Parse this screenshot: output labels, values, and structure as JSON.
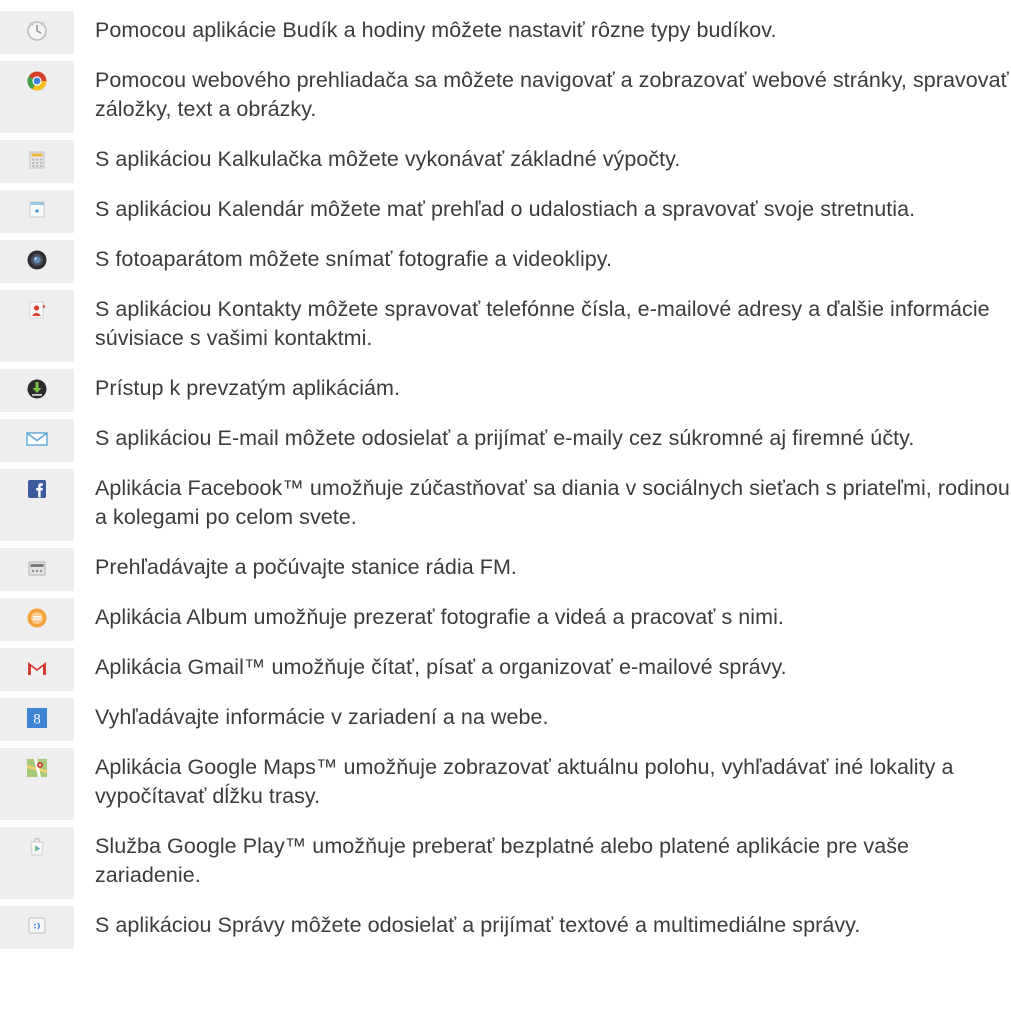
{
  "items": [
    {
      "icon": "clock-icon",
      "text": "Pomocou aplikácie Budík a hodiny môžete nastaviť rôzne typy budíkov."
    },
    {
      "icon": "browser-icon",
      "text": "Pomocou webového prehliadača sa môžete navigovať a zobrazovať webové stránky, spravovať záložky, text a obrázky."
    },
    {
      "icon": "calculator-icon",
      "text": "S aplikáciou Kalkulačka môžete vykonávať základné výpočty."
    },
    {
      "icon": "calendar-icon",
      "text": "S aplikáciou Kalendár môžete mať prehľad o udalostiach a spravovať svoje stretnutia."
    },
    {
      "icon": "camera-icon",
      "text": "S fotoaparátom môžete snímať fotografie a videoklipy."
    },
    {
      "icon": "contacts-icon",
      "text": "S aplikáciou Kontakty môžete spravovať telefónne čísla, e-mailové adresy a ďalšie informácie súvisiace s vašimi kontaktmi."
    },
    {
      "icon": "download-icon",
      "text": "Prístup k prevzatým aplikáciám."
    },
    {
      "icon": "email-icon",
      "text": "S aplikáciou E-mail môžete odosielať a prijímať e-maily cez súkromné aj firemné účty."
    },
    {
      "icon": "facebook-icon",
      "text": "Aplikácia Facebook™ umožňuje zúčastňovať sa diania v sociálnych sieťach s priateľmi, rodinou a kolegami po celom svete."
    },
    {
      "icon": "fm-radio-icon",
      "text": "Prehľadávajte a počúvajte stanice rádia FM."
    },
    {
      "icon": "album-icon",
      "text": "Aplikácia Album umožňuje prezerať fotografie a videá a pracovať s nimi."
    },
    {
      "icon": "gmail-icon",
      "text": "Aplikácia Gmail™ umožňuje čítať, písať a organizovať e-mailové správy."
    },
    {
      "icon": "google-search-icon",
      "text": "Vyhľadávajte informácie v zariadení a na webe."
    },
    {
      "icon": "google-maps-icon",
      "text": "Aplikácia Google Maps™ umožňuje zobrazovať aktuálnu polohu, vyhľadávať iné lokality a vypočítavať dĺžku trasy."
    },
    {
      "icon": "google-play-icon",
      "text": "Služba Google Play™ umožňuje preberať bezplatné alebo platené aplikácie pre vaše zariadenie."
    },
    {
      "icon": "messaging-icon",
      "text": "S aplikáciou Správy môžete odosielať a prijímať textové a multimediálne správy."
    }
  ]
}
